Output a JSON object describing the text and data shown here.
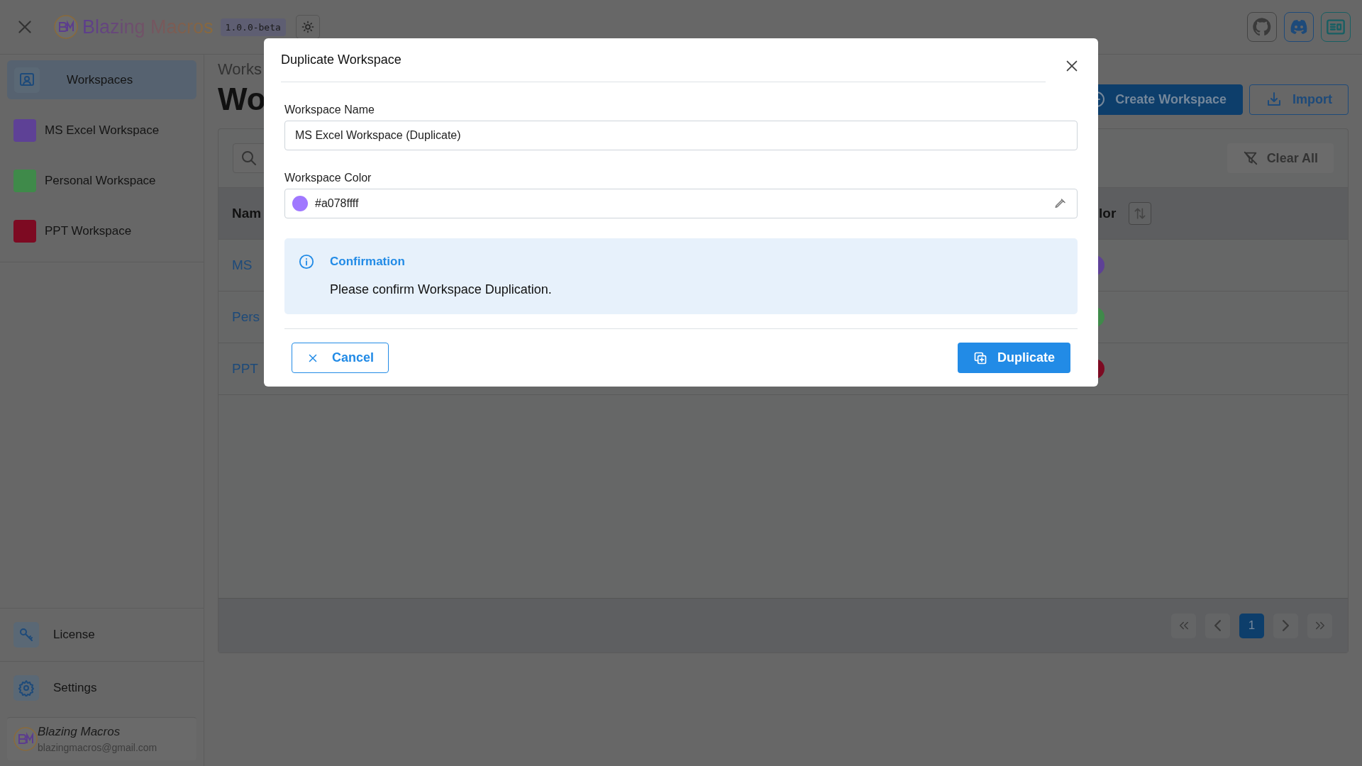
{
  "header": {
    "app_name": "Blazing Macros",
    "version": "1.0.0-beta"
  },
  "sidebar": {
    "items": [
      {
        "kind": "nav",
        "label": "Workspaces",
        "selected": true
      },
      {
        "kind": "workspace",
        "label": "MS Excel Workspace",
        "color": "#5e4196",
        "selected": false
      },
      {
        "kind": "workspace",
        "label": "Personal Workspace",
        "color": "#3f8a4a",
        "selected": false
      },
      {
        "kind": "workspace",
        "label": "PPT Workspace",
        "color": "#7d0a22",
        "selected": false
      }
    ],
    "footer_items": [
      {
        "label": "License"
      },
      {
        "label": "Settings"
      }
    ],
    "user": {
      "name": "Blazing Macros",
      "email": "blazingmacros@gmail.com"
    }
  },
  "page": {
    "breadcrumb": "Works",
    "title": "Wo",
    "buttons": [
      "Create Workspace",
      "Import"
    ],
    "clear_filters": "Clear All",
    "columns": [
      "Nam",
      "lor"
    ],
    "rows": [
      {
        "name": "MS",
        "color": "#5e4196"
      },
      {
        "name": "Pers",
        "color": "#3f8a4a"
      },
      {
        "name": "PPT",
        "color": "#7d0a22"
      }
    ],
    "pages": [
      {
        "label": "1",
        "selected": true
      }
    ]
  },
  "dialog": {
    "title": "Duplicate Workspace",
    "name_label": "Workspace Name",
    "name_value": "MS Excel Workspace (Duplicate)",
    "color_label": "Workspace Color",
    "color_value": "#a078ffff",
    "color": "#a078ff",
    "alert": {
      "title": "Confirmation",
      "message": "Please confirm Workspace Duplication."
    },
    "cancel": "Cancel",
    "confirm": "Duplicate"
  }
}
